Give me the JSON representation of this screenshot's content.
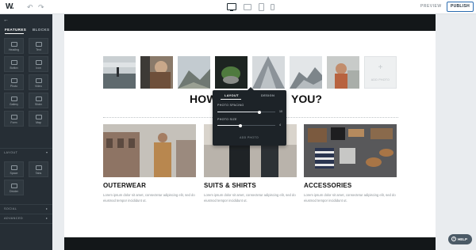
{
  "topbar": {
    "logo_text": "W.",
    "undo_icon": "undo-icon",
    "redo_icon": "redo-icon",
    "preview_label": "PREVIEW",
    "publish_label": "PUBLISH"
  },
  "sidebar": {
    "tabs": [
      "FEATURES",
      "BLOCKS"
    ],
    "tiles": [
      {
        "label": "Heading",
        "icon": "heading-icon"
      },
      {
        "label": "Text",
        "icon": "text-icon"
      },
      {
        "label": "Button",
        "icon": "button-icon"
      },
      {
        "label": "Icon",
        "icon": "star-icon"
      },
      {
        "label": "Photo",
        "icon": "photo-icon"
      },
      {
        "label": "Video",
        "icon": "video-icon"
      },
      {
        "label": "Gallery",
        "icon": "gallery-icon"
      },
      {
        "label": "Slider",
        "icon": "slider-icon"
      },
      {
        "label": "Form",
        "icon": "form-icon"
      },
      {
        "label": "Map",
        "icon": "map-icon"
      }
    ],
    "layout_section": "LAYOUT",
    "layout_tiles": [
      {
        "label": "Space",
        "icon": "space-icon"
      },
      {
        "label": "Tabs",
        "icon": "tabs-icon"
      },
      {
        "label": "Divider",
        "icon": "divider-icon"
      }
    ],
    "social_section": "SOCIAL",
    "advanced_section": "ADVANCED"
  },
  "canvas": {
    "headline_left": "HOW",
    "headline_right": "YOU?",
    "add_photo_label": "ADD PHOTO",
    "cards": [
      {
        "title": "OUTERWEAR",
        "text": "Lorem ipsum dolor sit amet, consectetur adipiscing elit, sed do eiusmod tempor incididunt ut."
      },
      {
        "title": "SUITS & SHIRTS",
        "text": "Lorem ipsum dolor sit amet, consectetur adipiscing elit, sed do eiusmod tempor incididunt ut."
      },
      {
        "title": "ACCESSORIES",
        "text": "Lorem ipsum dolor sit amet, consectetur adipiscing elit, sed do eiusmod tempor incididunt ut."
      }
    ]
  },
  "popover": {
    "tabs": [
      "LAYOUT",
      "DESIGN"
    ],
    "photo_spacing_label": "PHOTO SPACING",
    "photo_spacing_value": "10",
    "photo_spacing_fraction": 0.72,
    "photo_size_label": "PHOTO SIZE",
    "photo_size_value": "4",
    "photo_size_fraction": 0.4,
    "button_label": "ADD PHOTO"
  },
  "help": {
    "label": "HELP"
  }
}
